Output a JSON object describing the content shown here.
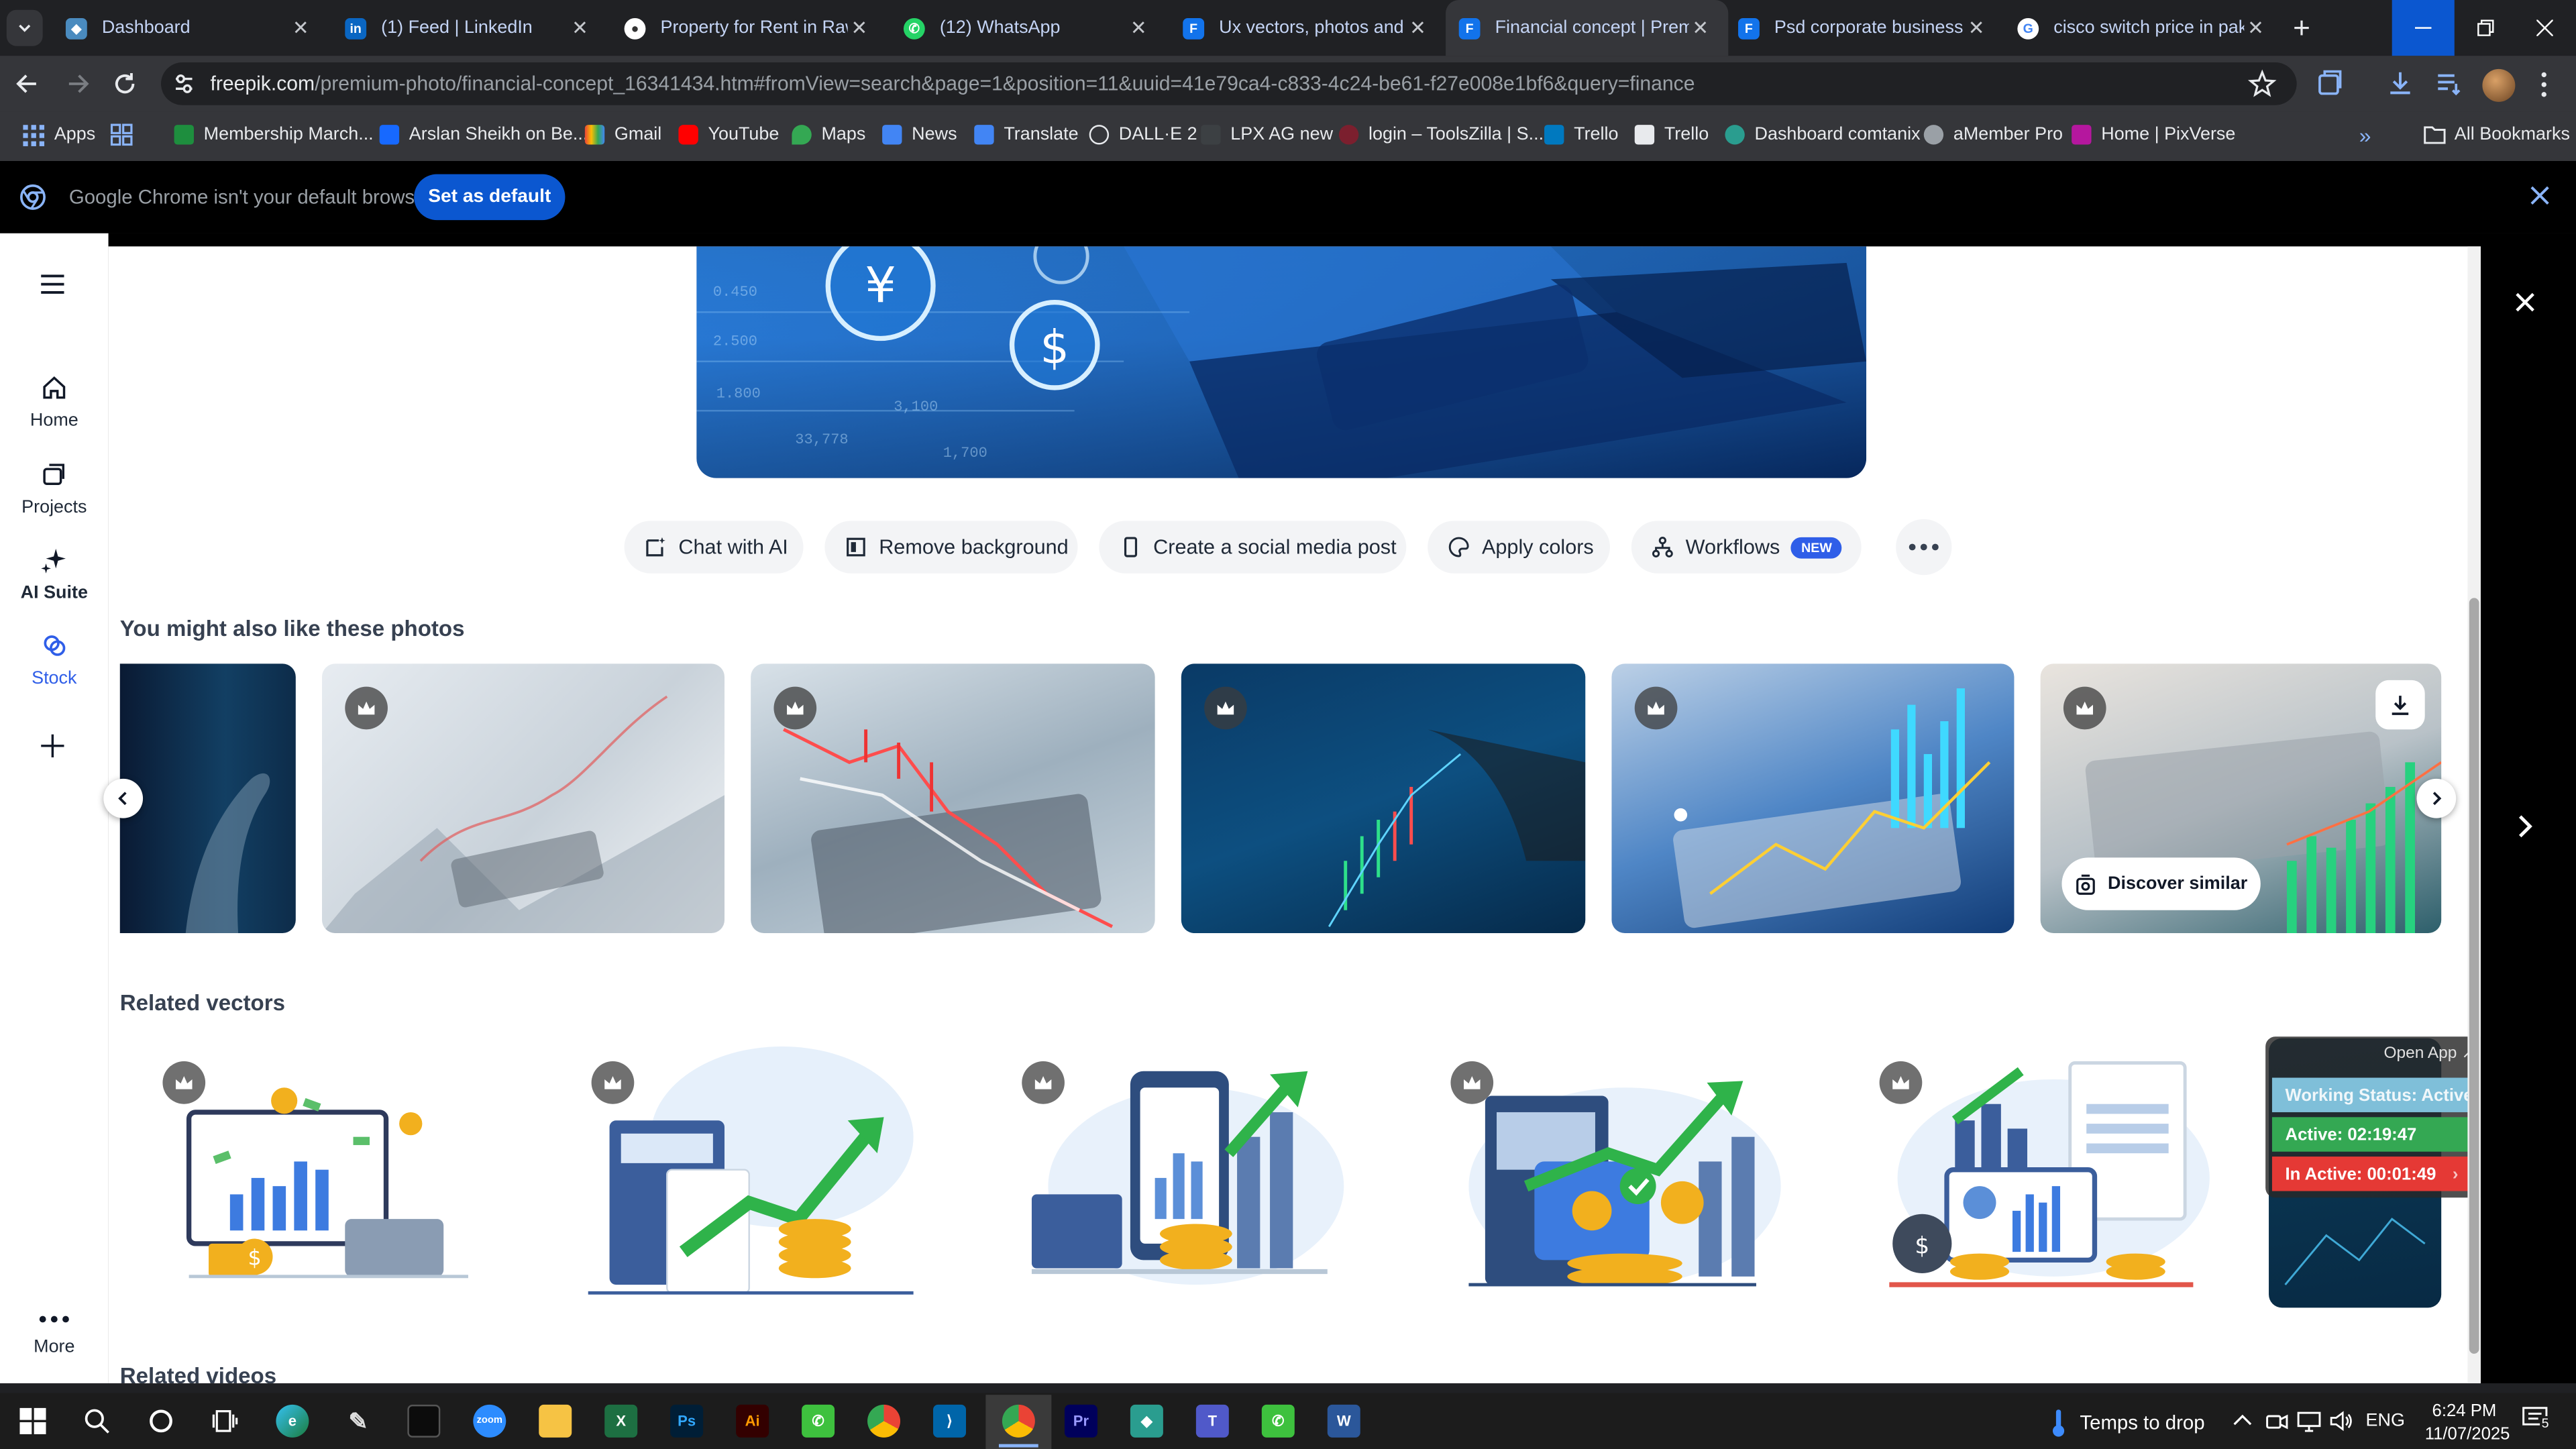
{
  "tabs": [
    {
      "title": "Dashboard",
      "active": false
    },
    {
      "title": "(1) Feed | LinkedIn",
      "active": false
    },
    {
      "title": "Property for Rent in Rawa",
      "active": false
    },
    {
      "title": "(12) WhatsApp",
      "active": false
    },
    {
      "title": "Ux vectors, photos and PS",
      "active": false
    },
    {
      "title": "Financial concept | Premi",
      "active": true
    },
    {
      "title": "Psd corporate business fl",
      "active": false
    },
    {
      "title": "cisco switch price in paki",
      "active": false
    }
  ],
  "address": {
    "domain": "freepik.com",
    "path": "/premium-photo/financial-concept_16341434.htm#fromView=search&page=1&position=11&uuid=41e79ca4-c833-4c24-be61-f27e008e1bf6&query=finance"
  },
  "bookmarks": {
    "apps": "Apps",
    "items": [
      "Membership March...",
      "Arslan Sheikh on Be...",
      "Gmail",
      "YouTube",
      "Maps",
      "News",
      "Translate",
      "DALL·E 2",
      "LPX AG new",
      "login – ToolsZilla | S...",
      "Trello",
      "Trello",
      "Dashboard comtanix",
      "aMember Pro",
      "Home | PixVerse"
    ],
    "all": "All Bookmarks"
  },
  "infobar": {
    "message": "Google Chrome isn't your default browser",
    "button": "Set as default"
  },
  "sidebar": {
    "items": [
      "Home",
      "Projects",
      "AI Suite",
      "Stock"
    ],
    "more": "More"
  },
  "actions": {
    "buttons": [
      "Chat with AI",
      "Remove background",
      "Create a social media post",
      "Apply colors",
      "Workflows"
    ],
    "new_badge": "NEW"
  },
  "sections": {
    "photos_title": "You might also like these photos",
    "vectors_title": "Related vectors",
    "videos_title": "Related videos"
  },
  "photos": {
    "discover": "Discover similar"
  },
  "overlay": {
    "open_app": "Open App ↗",
    "status": "Working Status: Active",
    "active": "Active: 02:19:47",
    "inactive": "In Active: 00:01:49"
  },
  "taskbar": {
    "weather": "Temps to drop",
    "lang": "ENG",
    "time": "6:24 PM",
    "date": "11/07/2025",
    "notif_count": "5"
  },
  "colors": {
    "accent": "#0b57d0",
    "freepik_blue": "#2f5ee8",
    "status_active": "#34a853",
    "status_inactive": "#e53935"
  }
}
